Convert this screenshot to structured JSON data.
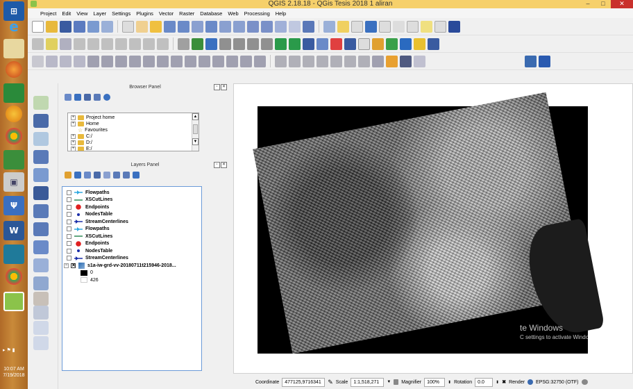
{
  "window": {
    "title": "QGIS 2.18.18 - QGis Tesis 2018 1 aliran",
    "minimize": "–",
    "maximize": "□",
    "close": "✕"
  },
  "taskbar": {
    "time": "10:07 AM",
    "date": "7/19/2018",
    "start_icon": "windows-logo-icon"
  },
  "menu": [
    "Project",
    "Edit",
    "View",
    "Layer",
    "Settings",
    "Plugins",
    "Vector",
    "Raster",
    "Database",
    "Web",
    "Processing",
    "Help"
  ],
  "browser_panel": {
    "title": "Browser Panel",
    "items": [
      {
        "label": "Project home",
        "expander": "+",
        "icon": "folder-icon"
      },
      {
        "label": "Home",
        "expander": "+",
        "icon": "folder-icon"
      },
      {
        "label": "Favourites",
        "expander": "",
        "icon": "star-icon"
      },
      {
        "label": "C:/",
        "expander": "+",
        "icon": "folder-icon"
      },
      {
        "label": "D:/",
        "expander": "+",
        "icon": "folder-icon"
      },
      {
        "label": "E:/",
        "expander": "+",
        "icon": "folder-icon"
      }
    ]
  },
  "layers_panel": {
    "title": "Layers Panel",
    "layers": [
      {
        "label": "Flowpaths",
        "symbol": "flowpath",
        "color": "#2fa8e0"
      },
      {
        "label": "XSCutLines",
        "symbol": "line",
        "color": "#2e8b57"
      },
      {
        "label": "Endpoints",
        "symbol": "dot-large",
        "color": "#e02020"
      },
      {
        "label": "NodesTable",
        "symbol": "dot-small",
        "color": "#1a2ea8"
      },
      {
        "label": "StreamCenterlines",
        "symbol": "arrow",
        "color": "#1a2ea8"
      },
      {
        "label": "Flowpaths",
        "symbol": "flowpath",
        "color": "#2fa8e0"
      },
      {
        "label": "XSCutLines",
        "symbol": "line",
        "color": "#2e8b57"
      },
      {
        "label": "Endpoints",
        "symbol": "dot-large",
        "color": "#e02020"
      },
      {
        "label": "NodesTable",
        "symbol": "dot-small",
        "color": "#1a2ea8"
      },
      {
        "label": "StreamCenterlines",
        "symbol": "arrow",
        "color": "#1a2ea8"
      }
    ],
    "raster_layer": {
      "label": "s1a-iw-grd-vv-20180711t215946-2018...",
      "checked_mark": "✕",
      "legend_min": "0",
      "legend_max": "426"
    }
  },
  "watermark": {
    "line1": "te Windows",
    "line2": "C settings to activate Windows."
  },
  "statusbar": {
    "coordinate_label": "Coordinate",
    "coordinate_value": "477125,9716341",
    "scale_label": "Scale",
    "scale_value": "1:1,518,271",
    "magnifier_label": "Magnifier",
    "magnifier_value": "100%",
    "rotation_label": "Rotation",
    "rotation_value": "0.0",
    "render_label": "Render",
    "crs_label": "EPSG:32750 (OTF)"
  }
}
